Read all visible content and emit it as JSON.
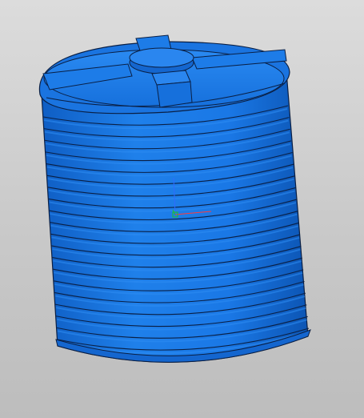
{
  "viewport": {
    "background_top": "#dcdcdc",
    "background_bottom": "#bdbdbd"
  },
  "model": {
    "name": "cylindrical-ribbed-tank",
    "body_color": "#1a78e6",
    "shade_color": "#0d58b8",
    "highlight_color": "#2d8cf3",
    "edge_color": "#0a1f44",
    "rib_count": 20
  },
  "triad": {
    "x_axis_color": "#ff3b3b",
    "y_axis_color": "#23c223",
    "z_axis_color": "#2f6bff"
  }
}
